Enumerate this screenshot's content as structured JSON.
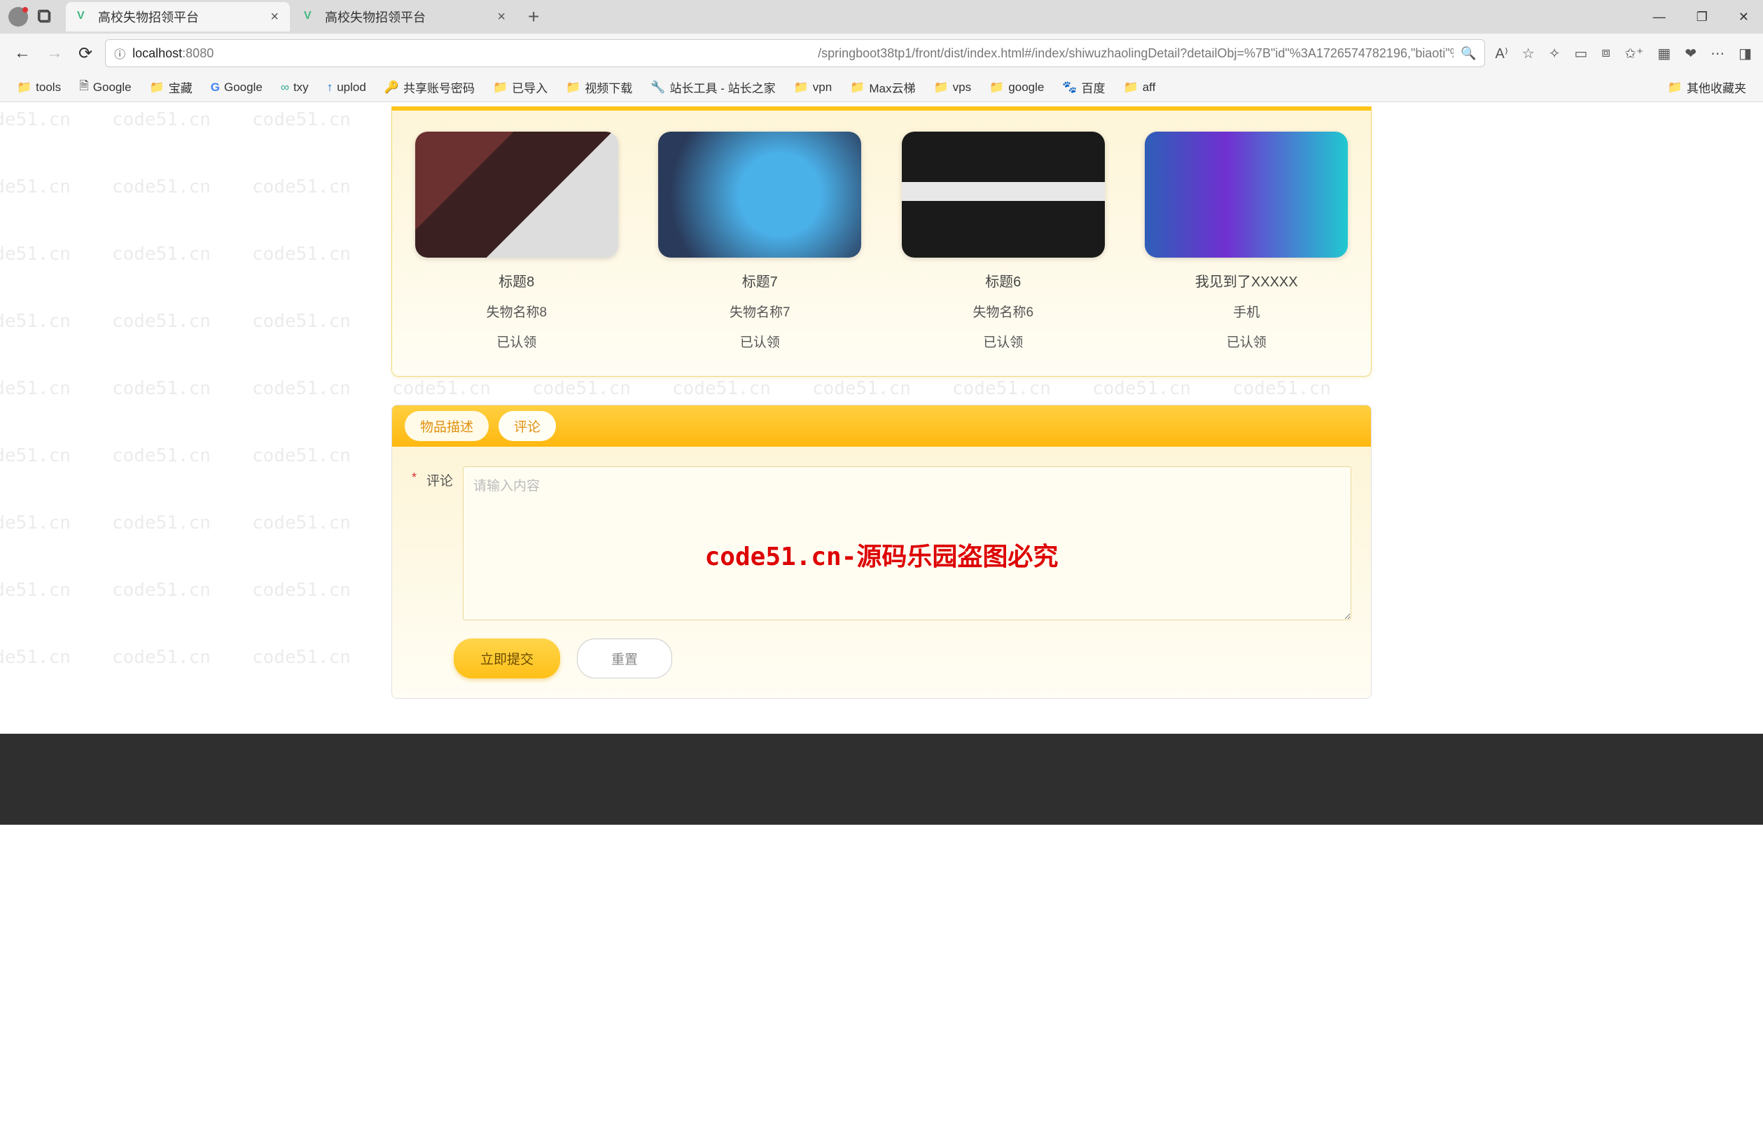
{
  "browser": {
    "tabs": [
      {
        "title": "高校失物招领平台"
      },
      {
        "title": "高校失物招领平台"
      }
    ],
    "url_host": "localhost",
    "url_port": ":8080",
    "url_path": "/springboot38tp1/front/dist/index.html#/index/shiwuzhaolingDetail?detailObj=%7B\"id\"%3A1726574782196,\"biaoti\"%3A...",
    "bookmarks": [
      {
        "label": "tools",
        "icon": "folder"
      },
      {
        "label": "Google",
        "icon": "page"
      },
      {
        "label": "宝藏",
        "icon": "folder"
      },
      {
        "label": "Google",
        "icon": "g"
      },
      {
        "label": "txy",
        "icon": "cloud"
      },
      {
        "label": "uplod",
        "icon": "arrow"
      },
      {
        "label": "共享账号密码",
        "icon": "key"
      },
      {
        "label": "已导入",
        "icon": "folder"
      },
      {
        "label": "视频下载",
        "icon": "folder"
      },
      {
        "label": "站长工具 - 站长之家",
        "icon": "tool"
      },
      {
        "label": "vpn",
        "icon": "folder"
      },
      {
        "label": "Max云梯",
        "icon": "folder"
      },
      {
        "label": "vps",
        "icon": "folder"
      },
      {
        "label": "google",
        "icon": "folder"
      },
      {
        "label": "百度",
        "icon": "paw"
      },
      {
        "label": "aff",
        "icon": "folder"
      }
    ],
    "other_bookmarks": "其他收藏夹"
  },
  "items": [
    {
      "title": "标题8",
      "name": "失物名称8",
      "status": "已认领"
    },
    {
      "title": "标题7",
      "name": "失物名称7",
      "status": "已认领"
    },
    {
      "title": "标题6",
      "name": "失物名称6",
      "status": "已认领"
    },
    {
      "title": "我见到了XXXXX",
      "name": "手机",
      "status": "已认领"
    }
  ],
  "tabsSection": {
    "tab1": "物品描述",
    "tab2": "评论",
    "comment_label": "评论",
    "comment_placeholder": "请输入内容",
    "submit": "立即提交",
    "reset": "重置"
  },
  "overlay": "code51.cn-源码乐园盗图必究",
  "watermark": "code51.cn"
}
